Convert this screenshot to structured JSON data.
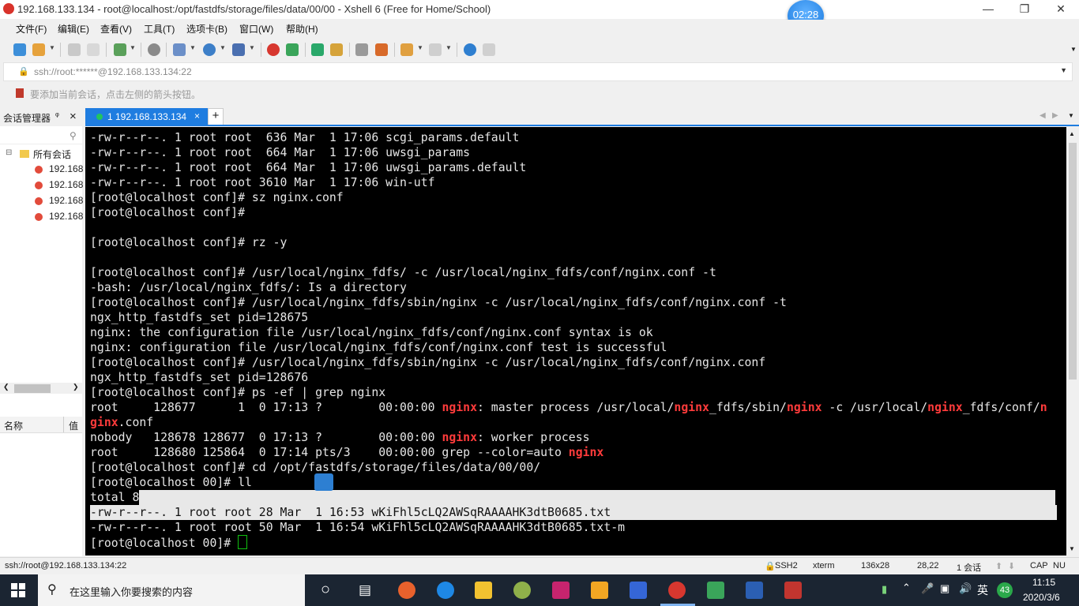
{
  "window": {
    "title": "192.168.133.134 - root@localhost:/opt/fastdfs/storage/files/data/00/00 - Xshell 6 (Free for Home/School)",
    "timer": "02:28",
    "min_icon": "minimize-icon",
    "max_icon": "restore-icon",
    "close_icon": "close-icon"
  },
  "menu": [
    "文件(F)",
    "编辑(E)",
    "查看(V)",
    "工具(T)",
    "选项卡(B)",
    "窗口(W)",
    "帮助(H)"
  ],
  "address": {
    "value": "ssh://root:******@192.168.133.134:22"
  },
  "hint": "要添加当前会话，点击左侧的箭头按钮。",
  "tab": {
    "label": "1 192.168.133.134",
    "close": "×",
    "add": "+"
  },
  "session_manager": {
    "title": "会话管理器",
    "pin": "ᵠ",
    "close": "×",
    "root": "所有会话",
    "items": [
      "192.168",
      "192.168",
      "192.168",
      "192.168"
    ],
    "props_name": "名称",
    "props_value": "值"
  },
  "terminal": {
    "lines": [
      "-rw-r--r--. 1 root root  636 Mar  1 17:06 scgi_params.default",
      "-rw-r--r--. 1 root root  664 Mar  1 17:06 uwsgi_params",
      "-rw-r--r--. 1 root root  664 Mar  1 17:06 uwsgi_params.default",
      "-rw-r--r--. 1 root root 3610 Mar  1 17:06 win-utf",
      "[root@localhost conf]# sz nginx.conf",
      "[root@localhost conf]#",
      "",
      "[root@localhost conf]# rz -y",
      "",
      "[root@localhost conf]# /usr/local/nginx_fdfs/ -c /usr/local/nginx_fdfs/conf/nginx.conf -t",
      "-bash: /usr/local/nginx_fdfs/: Is a directory",
      "[root@localhost conf]# /usr/local/nginx_fdfs/sbin/nginx -c /usr/local/nginx_fdfs/conf/nginx.conf -t",
      "ngx_http_fastdfs_set pid=128675",
      "nginx: the configuration file /usr/local/nginx_fdfs/conf/nginx.conf syntax is ok",
      "nginx: configuration file /usr/local/nginx_fdfs/conf/nginx.conf test is successful",
      "[root@localhost conf]# /usr/local/nginx_fdfs/sbin/nginx -c /usr/local/nginx_fdfs/conf/nginx.conf",
      "ngx_http_fastdfs_set pid=128676",
      "[root@localhost conf]# ps -ef | grep nginx"
    ],
    "ps1_a": "root     128677      1  0 17:13 ?        00:00:00 ",
    "ps1_b": ": master process /usr/local/",
    "ps1_c": "_fdfs/sbin/",
    "ps1_d": " -c /usr/local/",
    "ps1_e": "_fdfs/conf/",
    "ps1_f": "n",
    "ps2_a": "ginx",
    "ps2_b": ".conf",
    "ps3_a": "nobody   128678 128677  0 17:13 ?        00:00:00 ",
    "ps3_b": ": worker process",
    "ps4_a": "root     128680 125864  0 17:14 pts/3    00:00:00 grep --color=auto ",
    "keyword": "nginx",
    "after": [
      "[root@localhost conf]# cd /opt/fastdfs/storage/files/data/00/00/",
      "[root@localhost 00]# ll"
    ],
    "total": "total 8",
    "sel_line": "-rw-r--r--. 1 root root 28 Mar  1 16:53 wKiFhl5cLQ2AWSqRAAAAHK3dtB0685.txt",
    "last_file": "-rw-r--r--. 1 root root 50 Mar  1 16:54 wKiFhl5cLQ2AWSqRAAAAHK3dtB0685.txt-m",
    "prompt": "[root@localhost 00]# "
  },
  "status": {
    "left": "ssh://root@192.168.133.134:22",
    "proto": "SSH2",
    "term": "xterm",
    "size": "136x28",
    "pos": "28,22",
    "sessions": "1 会话",
    "cap": "CAP",
    "num": "NU"
  },
  "taskbar": {
    "search_placeholder": "在这里输入你要搜索的内容",
    "ime": "英",
    "badge": "43",
    "time": "11:15",
    "date": "2020/3/6"
  },
  "colors": {
    "accent": "#1f7de0",
    "terminal_bg": "#000000",
    "highlight": "#ff3b3b"
  }
}
